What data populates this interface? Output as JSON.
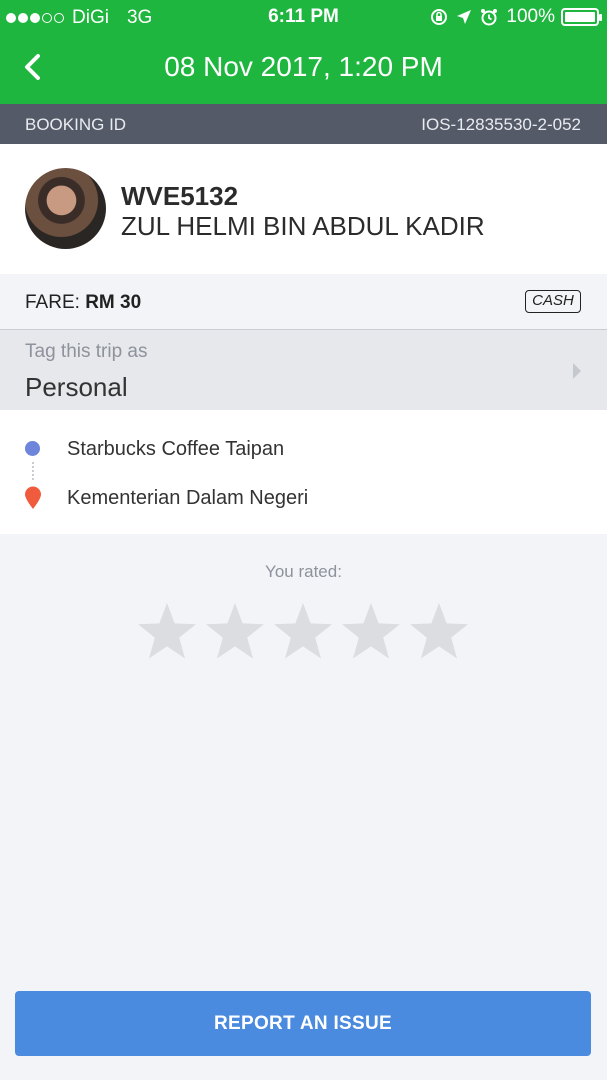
{
  "status_bar": {
    "carrier": "DiGi",
    "network": "3G",
    "time": "6:11 PM",
    "battery": "100%"
  },
  "nav": {
    "title": "08 Nov 2017, 1:20 PM"
  },
  "booking": {
    "label": "BOOKING ID",
    "id": "IOS-12835530-2-052"
  },
  "driver": {
    "plate": "WVE5132",
    "name": "ZUL HELMI BIN ABDUL KADIR"
  },
  "fare": {
    "label": "FARE:",
    "amount": "RM 30",
    "payment_method": "CASH"
  },
  "tag": {
    "label": "Tag this trip as",
    "value": "Personal"
  },
  "route": {
    "pickup": "Starbucks Coffee Taipan",
    "dropoff": "Kementerian Dalam Negeri"
  },
  "rating": {
    "label": "You rated:",
    "stars_filled": 0,
    "stars_total": 5
  },
  "actions": {
    "report_label": "REPORT AN ISSUE"
  },
  "colors": {
    "header_green": "#1fb63f",
    "booking_bar": "#545a68",
    "pickup_blue": "#6d85db",
    "dropoff_red": "#ef5b3c",
    "button_blue": "#4a8be0",
    "star_gray": "#dcdde1"
  }
}
